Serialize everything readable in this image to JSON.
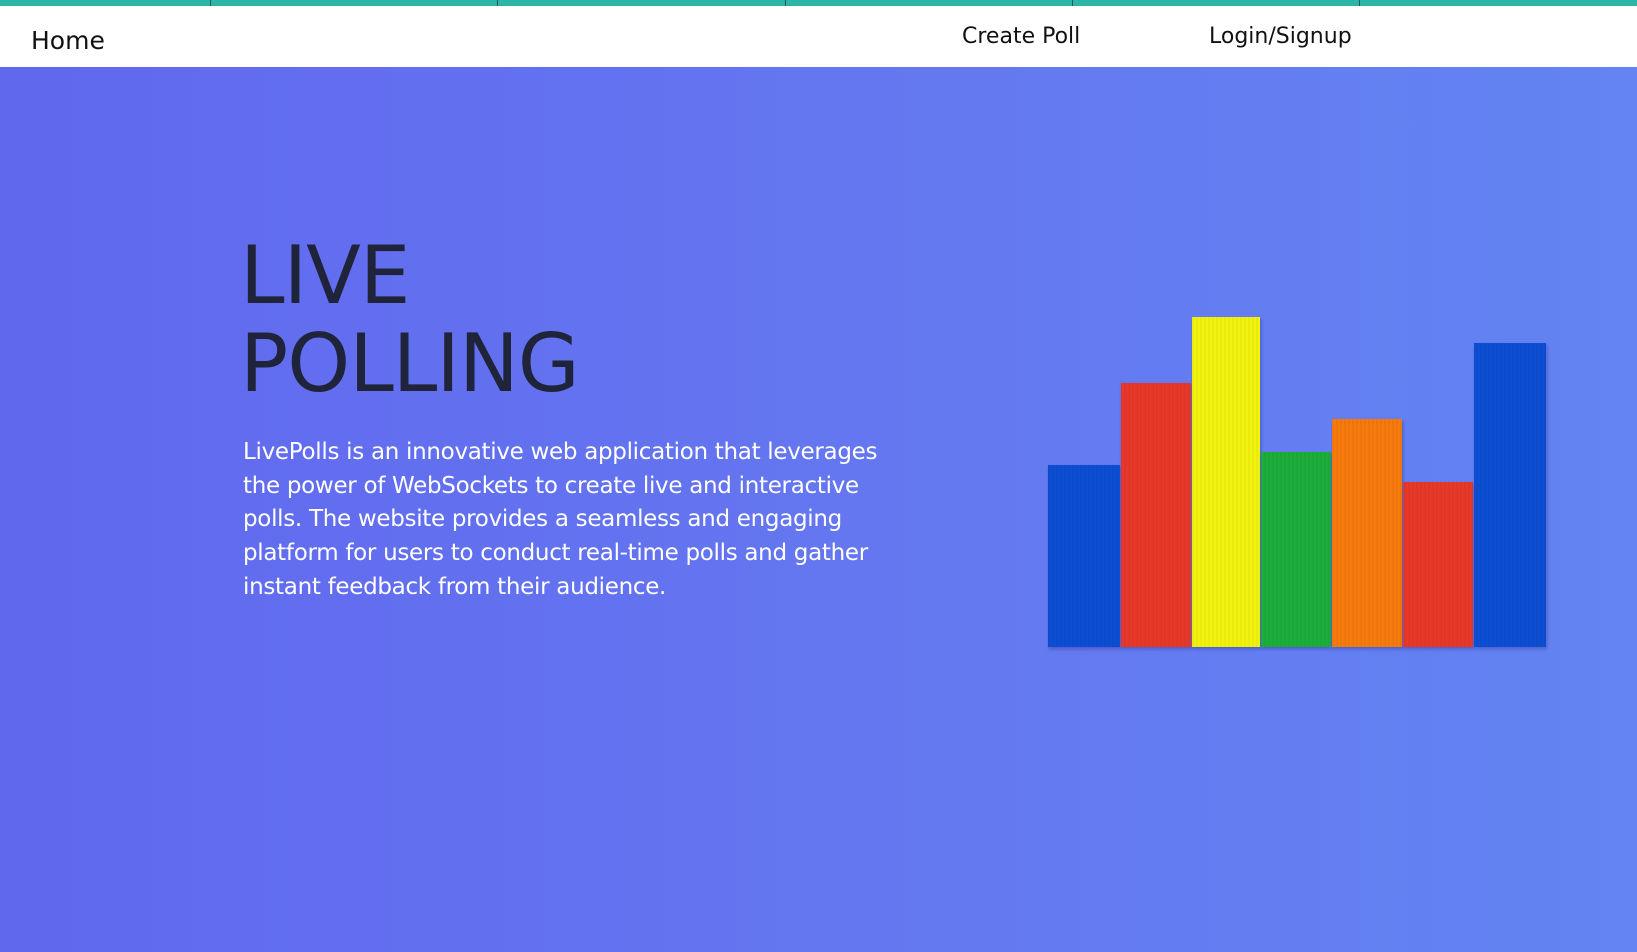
{
  "nav": {
    "home_label": "Home",
    "create_poll_label": "Create Poll",
    "login_label": "Login/Signup"
  },
  "hero": {
    "title_line1": "LIVE",
    "title_line2": "POLLING",
    "description": "LivePolls is an innovative web application that leverages the power of WebSockets to create live and interactive polls. The website provides a seamless and engaging platform for users to conduct real-time polls and gather instant feedback from their audience."
  },
  "colors": {
    "accent_strip": "#2bb5a6",
    "hero_gradient_start": "#6068ee",
    "hero_gradient_end": "#6384f2",
    "title_color": "#20243a",
    "bar_blue": "#0a4fd4",
    "bar_red": "#e8392a",
    "bar_yellow": "#f2f20a",
    "bar_green": "#1aae3a",
    "bar_orange": "#f77a0a"
  },
  "image": {
    "subject": "colored-block-bar-graph",
    "bar_colors": [
      "bar_blue",
      "bar_red",
      "bar_yellow",
      "bar_green",
      "bar_orange",
      "bar_red",
      "bar_blue"
    ],
    "relative_heights": [
      0.55,
      0.8,
      1.0,
      0.59,
      0.69,
      0.5,
      0.92
    ]
  }
}
